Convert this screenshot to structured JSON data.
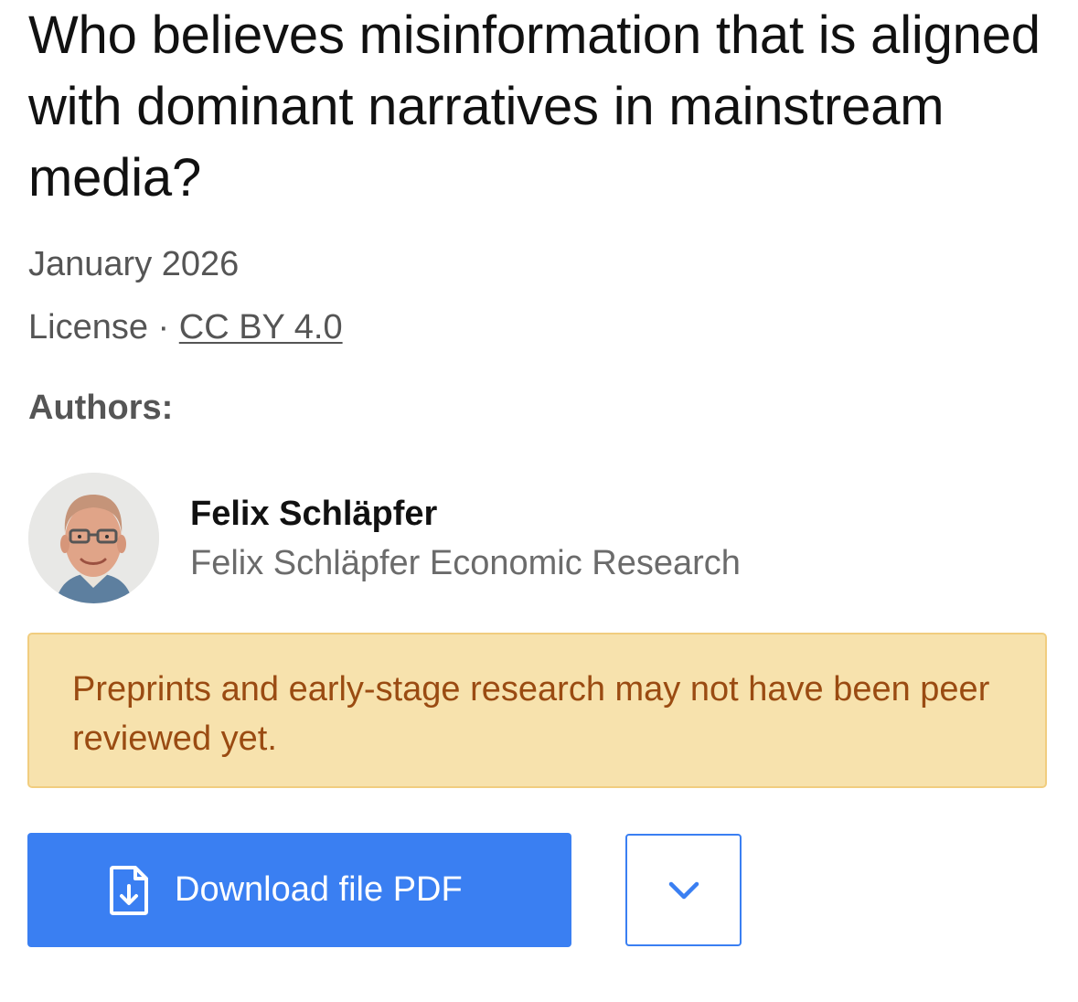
{
  "paper": {
    "title": "Who believes misinformation that is aligned with dominant narratives in mainstream media?",
    "date": "January 2026",
    "license_label": "License",
    "license_separator": " · ",
    "license_link": "CC BY 4.0"
  },
  "authors": {
    "heading": "Authors:",
    "items": [
      {
        "name": "Felix Schläpfer",
        "affiliation": "Felix Schläpfer Economic Research",
        "avatar_icon": "author-photo"
      }
    ]
  },
  "notice": {
    "text": "Preprints and early-stage research may not have been peer reviewed yet.",
    "background_color": "#f7e2ad",
    "text_color": "#9a4b12"
  },
  "actions": {
    "download_label": "Download file PDF",
    "download_icon": "file-download-icon",
    "dropdown_icon": "chevron-down-icon",
    "accent_color": "#3a7ff2"
  }
}
